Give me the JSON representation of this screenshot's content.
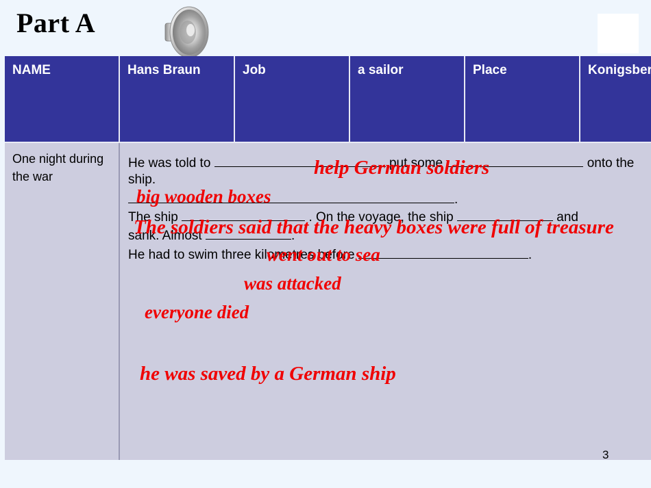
{
  "slide": {
    "title": "Part A",
    "page_number": "3",
    "background_color": "#eff6fd",
    "header_color": "#33349a",
    "body_color": "#cdcddf",
    "answer_color": "#f00000"
  },
  "icons": {
    "speaker": "speaker-icon",
    "placeholder": "image-placeholder"
  },
  "table": {
    "header_cells": [
      {
        "label": "NAME"
      },
      {
        "label": "Hans Braun"
      },
      {
        "label": "Job"
      },
      {
        "label": "a sailor"
      },
      {
        "label": "Place"
      },
      {
        "label": "Konigsberg"
      }
    ],
    "body": {
      "time_cell": "One night during the war",
      "passage_lines": [
        {
          "pre": "He was told to ",
          "blank1": "____________",
          "mid": "put some",
          "blank2": "_____________",
          "post": " onto the ship."
        },
        {
          "pre": "",
          "blank1": "",
          "mid": "",
          "blank2": "____________________________________",
          "post": "."
        },
        {
          "pre": "The ship ",
          "blank1": "___________________",
          "mid": ". On the voyage, the ship ",
          "blank2": "________________",
          "post": " and sank. Almost"
        },
        {
          "pre": "",
          "blank1": "________________",
          "mid": "",
          "blank2": "",
          "post": "."
        },
        {
          "pre": "He had to swim three kilometres before ",
          "blank1": "",
          "mid": "",
          "blank2": "_________________________",
          "post": "."
        }
      ],
      "line1_a": "He was told to",
      "line1_b": "put some",
      "line1_c": "onto the",
      "line2": "ship.",
      "line4_a": "The ship",
      "line4_b": ". On the voyage, the ship",
      "line4_c": "and",
      "line5_a": "sank. Almost",
      "line5_b": ".",
      "line6_a": "He had to swim three kilometres before",
      "line6_b": ".",
      "line3_end": "."
    },
    "answers": [
      {
        "text": "help German soldiers"
      },
      {
        "text": "big wooden boxes"
      },
      {
        "text": "The soldiers said that the heavy boxes were full of treasure"
      },
      {
        "text": "went out to sea"
      },
      {
        "text": "was attacked"
      },
      {
        "text": "everyone died"
      },
      {
        "text": "he was saved by a German ship"
      }
    ]
  }
}
